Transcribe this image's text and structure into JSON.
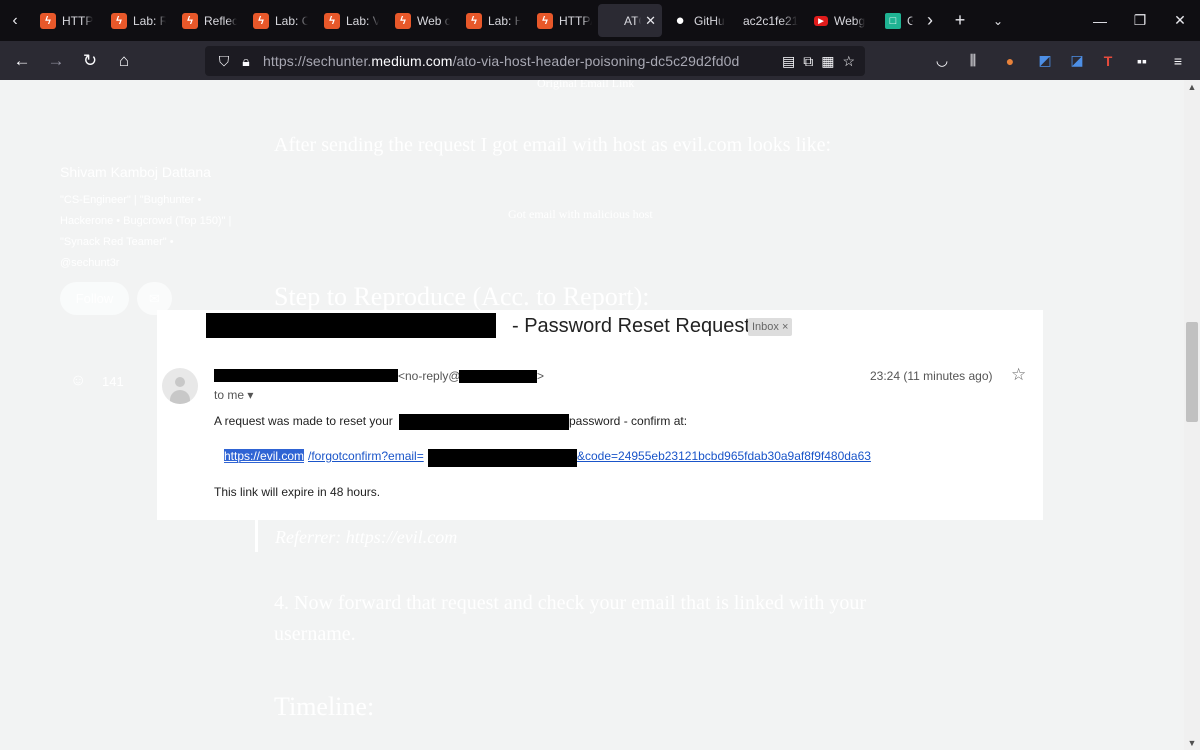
{
  "browser": {
    "tabs": [
      {
        "label": "HTTP",
        "icon": "bolt-icon",
        "active": false
      },
      {
        "label": "Lab: R",
        "icon": "bolt-icon",
        "active": false
      },
      {
        "label": "Reflec",
        "icon": "bolt-icon",
        "active": false
      },
      {
        "label": "Lab: C",
        "icon": "bolt-icon",
        "active": false
      },
      {
        "label": "Lab: V",
        "icon": "bolt-icon",
        "active": false
      },
      {
        "label": "Web c",
        "icon": "bolt-icon",
        "active": false
      },
      {
        "label": "Lab: H",
        "icon": "bolt-icon",
        "active": false
      },
      {
        "label": "HTTP/",
        "icon": "bolt-icon",
        "active": false
      },
      {
        "label": "ATC",
        "icon": "",
        "active": true
      },
      {
        "label": "GitHu",
        "icon": "github-icon",
        "active": false
      },
      {
        "label": "ac2c1fe21",
        "icon": "",
        "active": false
      },
      {
        "label": "Webg",
        "icon": "youtube-icon",
        "active": false
      },
      {
        "label": "GC",
        "icon": "gc-icon",
        "active": false
      }
    ],
    "url": {
      "prefix": "https://sechunter.",
      "domain": "medium.com",
      "path": "/ato-via-host-header-poisoning-dc5c29d2fd0d"
    }
  },
  "article": {
    "caption_top": "Original Email Link",
    "para_sent": "After sending the request I got email with host as evil.com looks like:",
    "caption_email": "Got email with malicious host",
    "heading_reproduce": "Step to Reproduce (Acc. to Report):",
    "quote": "Referrer: https://evil.com",
    "step_4": "4. Now forward that request and check your email that is linked with your username.",
    "heading_timeline": "Timeline:"
  },
  "sidebar": {
    "author": "Shivam Kamboj Dattana",
    "bio": "\"CS-Engineer\" | \"Bughunter • Hackerone • Bugcrowd (Top 150)\" | \"Synack Red Teamer\" • @sechunt3r",
    "follow": "Follow",
    "claps": "141"
  },
  "email": {
    "subject": "- Password Reset Request",
    "badge": "Inbox",
    "badge_close": "×",
    "from_suffix": "<no-reply@",
    "from_end": ">",
    "to": "to me",
    "time": "23:24 (11 minutes ago)",
    "line1_start": "A request was made to reset your",
    "line1_end": "password - confirm at:",
    "link_selected": "https://evil.com",
    "link_path": "/forgotconfirm?email=",
    "link_code": "&code=24955eb23121bcbd965fdab30a9af8f9f480da63",
    "expire": "This link will expire in 48 hours."
  }
}
